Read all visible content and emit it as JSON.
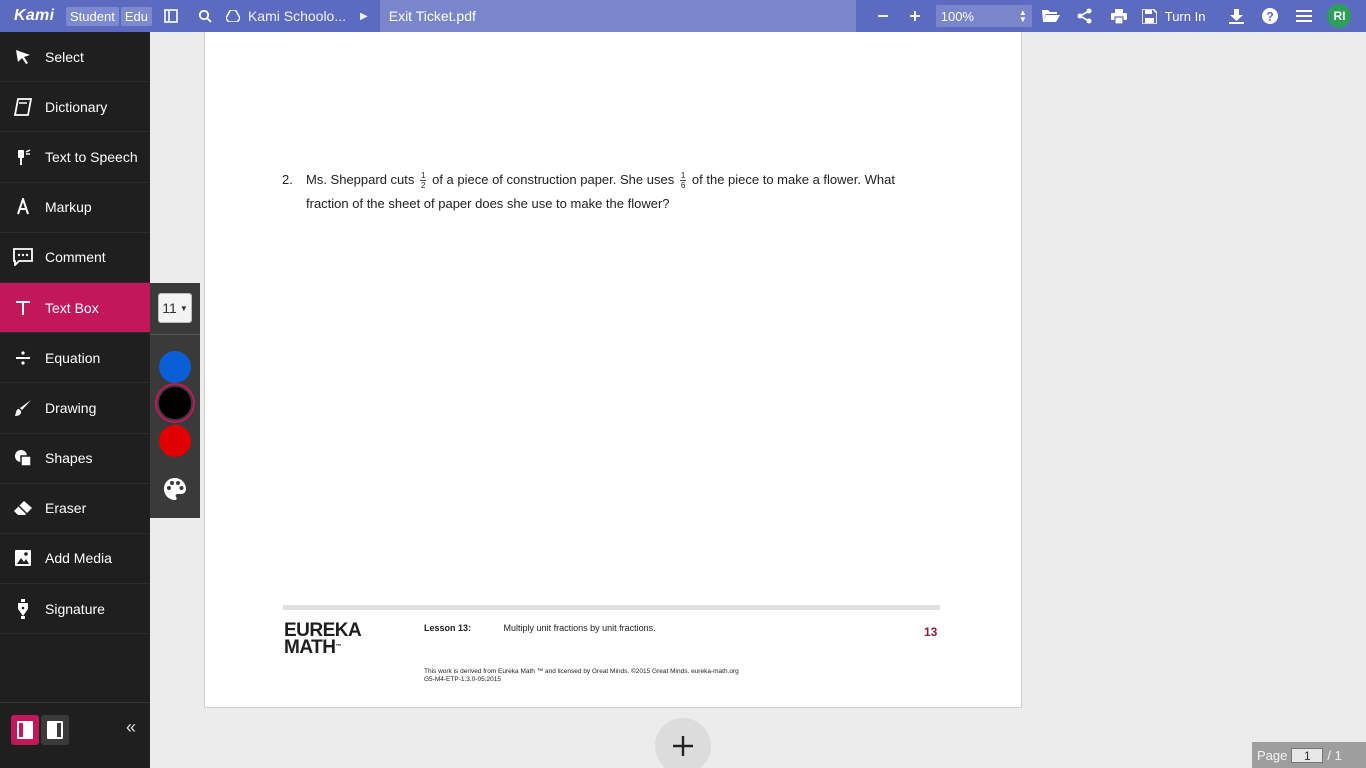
{
  "topbar": {
    "logo": "Kami",
    "badges": [
      "Student",
      "Edu"
    ],
    "breadcrumb": "Kami Schoolo...",
    "filename": "Exit Ticket.pdf",
    "zoom": "100%",
    "turn_in": "Turn In",
    "avatar": "RI",
    "bg_color": "#5c6bc0"
  },
  "sidebar": {
    "tools": [
      {
        "label": "Select",
        "icon": "cursor-icon"
      },
      {
        "label": "Dictionary",
        "icon": "book-icon"
      },
      {
        "label": "Text to Speech",
        "icon": "speaker-icon"
      },
      {
        "label": "Markup",
        "icon": "highlighter-icon"
      },
      {
        "label": "Comment",
        "icon": "comment-icon"
      },
      {
        "label": "Text Box",
        "icon": "text-icon",
        "active": true
      },
      {
        "label": "Equation",
        "icon": "divide-icon"
      },
      {
        "label": "Drawing",
        "icon": "brush-icon"
      },
      {
        "label": "Shapes",
        "icon": "shapes-icon"
      },
      {
        "label": "Eraser",
        "icon": "eraser-icon"
      },
      {
        "label": "Add Media",
        "icon": "image-icon"
      },
      {
        "label": "Signature",
        "icon": "pen-nib-icon"
      }
    ],
    "collapse_icon": "double-chevron-left-icon",
    "accent": "#c2185b"
  },
  "textbox_options": {
    "font_size": "11",
    "colors": [
      "#0a5fd6",
      "#000000",
      "#e00000"
    ],
    "selected_color": "#000000"
  },
  "document": {
    "question_number": "2.",
    "question_part1": "Ms. Sheppard cuts",
    "frac1_num": "1",
    "frac1_den": "2",
    "question_part2": "of a piece of construction paper.  She uses",
    "frac2_num": "1",
    "frac2_den": "6",
    "question_part3": "of the piece to make a flower.  What fraction of the sheet of paper does she use to make the flower?",
    "brand_line1": "EUREKA",
    "brand_line2": "MATH",
    "brand_mark": "™",
    "lesson_label": "Lesson 13:",
    "lesson_title": "Multiply unit fractions by unit fractions.",
    "page_number": "13",
    "license": "This work is derived from Eureka Math ™ and licensed by Great Minds. ©2015 Great Minds. eureka-math.org",
    "code": "G5-M4-ETP-1.3.0-05.2015"
  },
  "pager": {
    "label": "Page",
    "current": "1",
    "total": "/ 1"
  }
}
